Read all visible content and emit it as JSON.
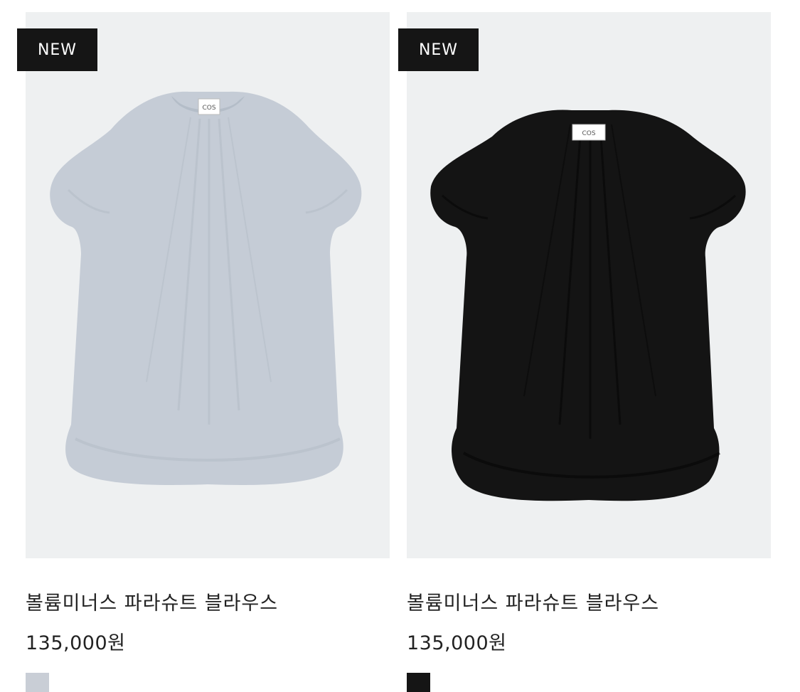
{
  "products": [
    {
      "badge": "NEW",
      "name": "볼륨미너스 파라슈트 블라우스",
      "price": "135,000원",
      "tag_text": "COS",
      "garment_color": "#c5ccd6",
      "shadow_color": "#a9b2be",
      "swatch_color": "#c9ced6"
    },
    {
      "badge": "NEW",
      "name": "볼륨미너스 파라슈트 블라우스",
      "price": "135,000원",
      "tag_text": "COS",
      "garment_color": "#141414",
      "shadow_color": "#050505",
      "swatch_color": "#151515"
    }
  ]
}
